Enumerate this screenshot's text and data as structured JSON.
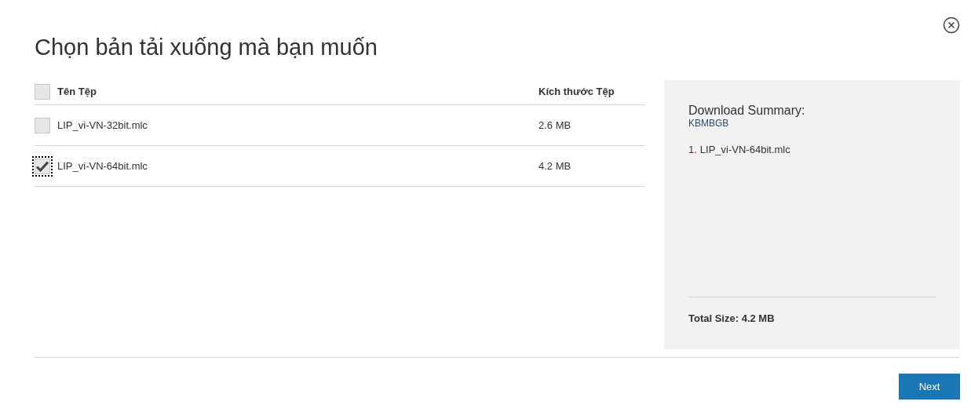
{
  "dialog": {
    "title": "Chọn bản tải xuống mà bạn muốn"
  },
  "table": {
    "select_all": {
      "checked": false
    },
    "columns": [
      "Tên Tệp",
      "Kích thước Tệp"
    ],
    "rows": [
      {
        "name": "LIP_vi-VN-32bit.mlc",
        "size": "2.6 MB",
        "checked": false,
        "focused": false
      },
      {
        "name": "LIP_vi-VN-64bit.mlc",
        "size": "4.2 MB",
        "checked": true,
        "focused": true
      }
    ]
  },
  "summary": {
    "title": "Download Summary:",
    "subtitle": "KBMBGB",
    "items": [
      {
        "number": "1.",
        "name": "LIP_vi-VN-64bit.mlc"
      }
    ],
    "total": "Total Size: 4.2 MB"
  },
  "buttons": [
    "Next"
  ]
}
